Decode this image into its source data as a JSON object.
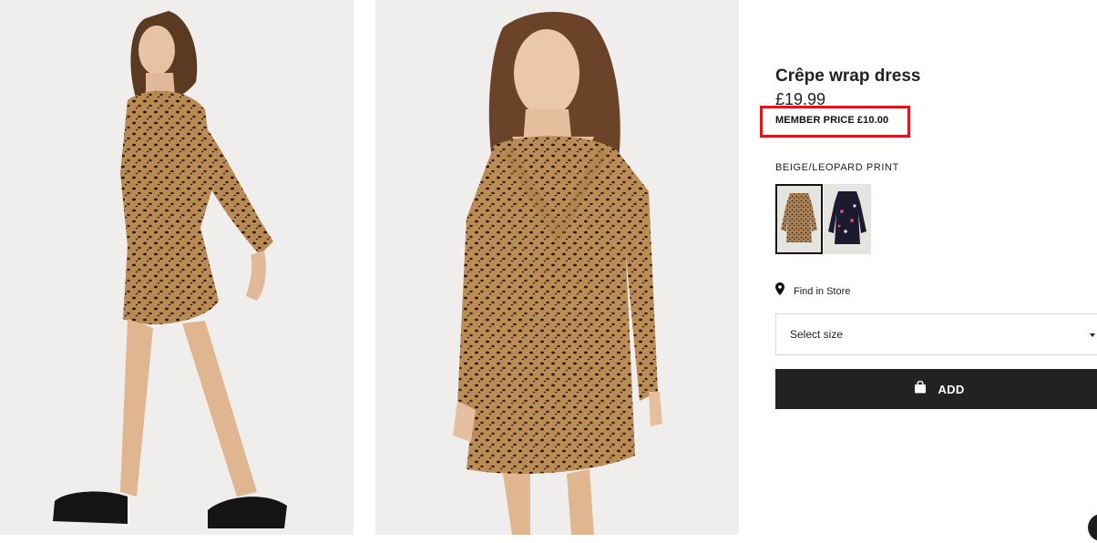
{
  "product": {
    "title": "Crêpe wrap dress",
    "price": "£19.99",
    "member_price": "MEMBER PRICE £10.00",
    "color_label": "BEIGE/LEOPARD PRINT"
  },
  "swatches": [
    {
      "name": "Beige/Leopard print",
      "selected": true
    },
    {
      "name": "Dark floral",
      "selected": false
    }
  ],
  "actions": {
    "find_in_store": "Find in Store",
    "size_placeholder": "Select size",
    "add_label": "ADD"
  },
  "icons": {
    "location": "location-pin-icon",
    "bag": "shopping-bag-icon",
    "caret": "caret-down-icon"
  },
  "colors": {
    "accent": "#222222",
    "highlight": "#e0141e",
    "photo_bg": "#efeeed"
  }
}
